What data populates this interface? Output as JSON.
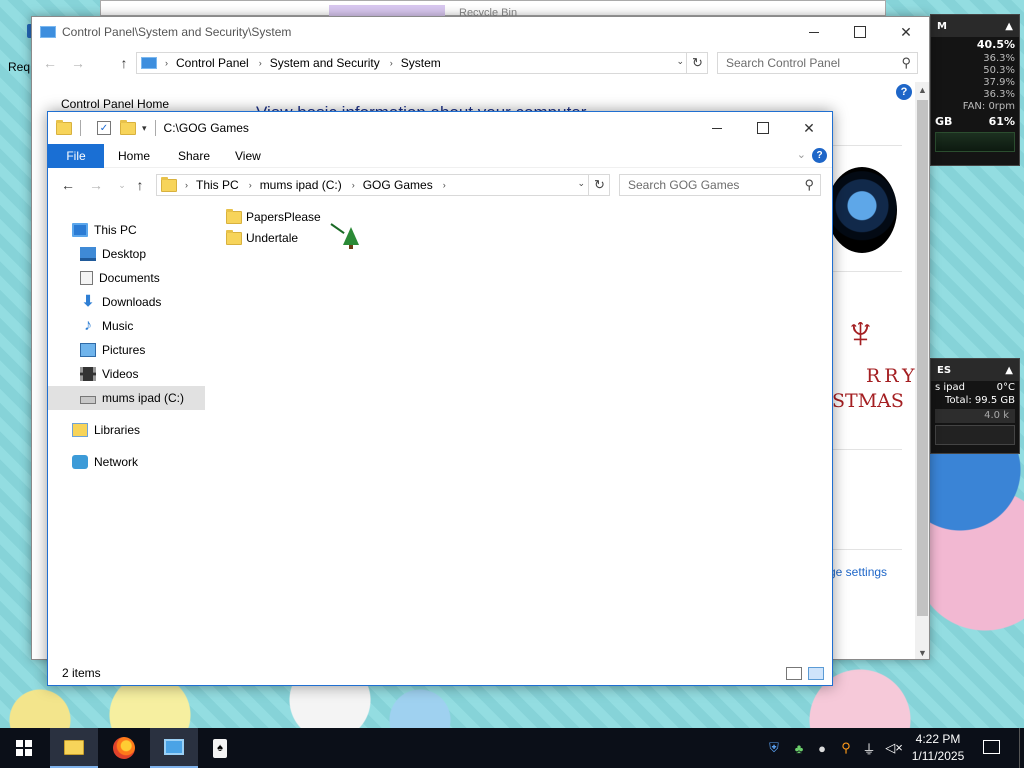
{
  "desktop": {
    "label_partial": "Req",
    "bg_window_title": "Recycle Bin"
  },
  "gadget_cpu": {
    "header": "M",
    "total": "40.5%",
    "cores": [
      "36.3%",
      "50.3%",
      "37.9%",
      "36.3%"
    ],
    "fan": "FAN: 0rpm",
    "mem_left": "GB",
    "mem_pct": "61%"
  },
  "gadget_disk": {
    "header": "ES",
    "drive": "s ipad",
    "temp": "0°C",
    "total": "Total: 99.5 GB",
    "rate": "4.0 k"
  },
  "control_panel": {
    "title": "Control Panel\\System and Security\\System",
    "address": [
      "Control Panel",
      "System and Security",
      "System"
    ],
    "search_placeholder": "Search Control Panel",
    "home_link": "Control Panel Home",
    "heading": "View basic information about your computer",
    "change_link": "ge settings",
    "xmas_line1": "RRY",
    "xmas_line2": "STMAS"
  },
  "explorer": {
    "title": "C:\\GOG Games",
    "ribbon_tabs": [
      "File",
      "Home",
      "Share",
      "View"
    ],
    "address": [
      "This PC",
      "mums ipad (C:)",
      "GOG Games"
    ],
    "search_placeholder": "Search GOG Games",
    "nav": {
      "this_pc": "This PC",
      "desktop": "Desktop",
      "documents": "Documents",
      "downloads": "Downloads",
      "music": "Music",
      "pictures": "Pictures",
      "videos": "Videos",
      "drive": "mums ipad (C:)",
      "libraries": "Libraries",
      "network": "Network"
    },
    "files": [
      "PapersPlease",
      "Undertale"
    ],
    "status": "2 items"
  },
  "taskbar": {
    "time": "4:22 PM",
    "date": "1/11/2025",
    "apps": [
      "start-icon",
      "file-explorer-icon",
      "firefox-icon",
      "control-panel-icon",
      "solitaire-icon"
    ],
    "tray_icons": [
      "windows-security-icon",
      "network-people-icon",
      "drop-icon",
      "search-key-icon",
      "usb-icon",
      "network-icon",
      "volume-muted-icon"
    ]
  }
}
